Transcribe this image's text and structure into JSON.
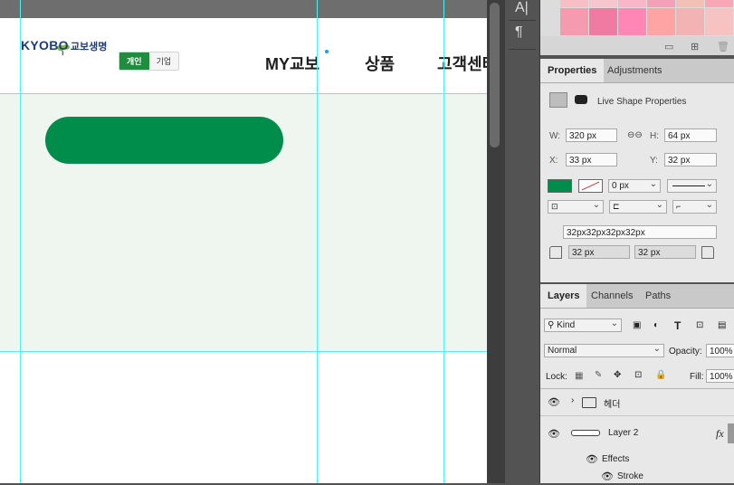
{
  "canvas": {
    "logo_en": "KYOBO",
    "logo_kr": "교보생명",
    "segment": [
      "개인",
      "기업"
    ],
    "nav": [
      "MY교보",
      "상품",
      "고객센터"
    ],
    "colors": {
      "brand_green": "#008c4a",
      "toggle_green": "#1f8c3e",
      "band_bg": "#eff6ef",
      "guide": "#4ff2f2"
    }
  },
  "tools": {
    "type_icon": "A|",
    "paragraph_icon": "¶"
  },
  "swatch_colors": [
    "#f7bfc5",
    "#f6c6cf",
    "#f8b6c8",
    "#f4a0b8",
    "#f2c0b5",
    "#f7a7b6",
    "#f69ab0",
    "#f07aa2",
    "#ff86b5",
    "#ffa4a4",
    "#f4b3b3"
  ],
  "properties": {
    "tabs": [
      "Properties",
      "Adjustments"
    ],
    "section": "Live Shape Properties",
    "w_label": "W:",
    "w": "320 px",
    "h_label": "H:",
    "h": "64 px",
    "x_label": "X:",
    "x": "33 px",
    "y_label": "Y:",
    "y": "32 px",
    "stroke_width": "0 px",
    "corner_summary": "32px32px32px32px",
    "corner_tl": "32 px",
    "corner_tr": "32 px",
    "fill_color": "#008c4a"
  },
  "layers": {
    "tabs": [
      "Layers",
      "Channels",
      "Paths"
    ],
    "filter_kind": "Kind",
    "blend_mode": "Normal",
    "opacity_label": "Opacity:",
    "opacity": "100%",
    "lock_label": "Lock:",
    "fill_label": "Fill:",
    "fill": "100%",
    "items": [
      {
        "name": "헤더",
        "type": "group"
      },
      {
        "name": "Layer 2",
        "type": "shape",
        "fx": "fx"
      },
      {
        "name": "Effects",
        "type": "effects"
      },
      {
        "name": "Stroke",
        "type": "effect"
      }
    ]
  }
}
